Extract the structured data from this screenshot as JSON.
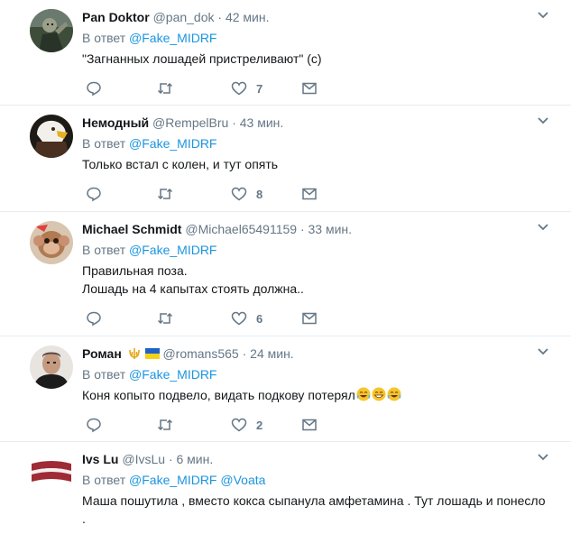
{
  "ui": {
    "reply_prefix": "В ответ",
    "dot": "·"
  },
  "tweets": [
    {
      "name": "Pan Doktor",
      "handle": "@pan_dok",
      "time": "42 мин.",
      "mentions": [
        "@Fake_MIDRF"
      ],
      "text_lines": [
        "\"Загнанных лошадей пристреливают\" (с)"
      ],
      "like_count": "7",
      "avatar_icon": "zombie-avatar"
    },
    {
      "name": "Немодный",
      "handle": "@RempelBru",
      "time": "43 мин.",
      "mentions": [
        "@Fake_MIDRF"
      ],
      "text_lines": [
        "Только встал с колен, и тут опять"
      ],
      "like_count": "8",
      "avatar_icon": "eagle-avatar"
    },
    {
      "name": "Michael Schmidt",
      "handle": "@Michael65491159",
      "time": "33 мин.",
      "mentions": [
        "@Fake_MIDRF"
      ],
      "text_lines": [
        "Правильная поза.",
        "Лошадь на 4 капытах стоять должна.."
      ],
      "like_count": "6",
      "avatar_icon": "monkey-avatar"
    },
    {
      "name": "Роман",
      "handle": "@romans565",
      "time": "24 мин.",
      "mentions": [
        "@Fake_MIDRF"
      ],
      "text_lines": [
        "Коня копыто подвело, видать подкову потерял"
      ],
      "like_count": "2",
      "avatar_icon": "man-avatar"
    },
    {
      "name": "Ivs Lu",
      "handle": "@IvsLu",
      "time": "6 мин.",
      "mentions": [
        "@Fake_MIDRF",
        "@Voata"
      ],
      "text_lines": [
        "Маша пошутила , вместо кокса сыпанула амфетамина . Тут лошадь и понесло",
        "."
      ],
      "like_count": "",
      "avatar_icon": "latvia-flag-avatar"
    }
  ],
  "colors": {
    "link": "#1b95e0",
    "muted": "#657786",
    "text": "#14171a",
    "divider": "#e6ecf0"
  }
}
